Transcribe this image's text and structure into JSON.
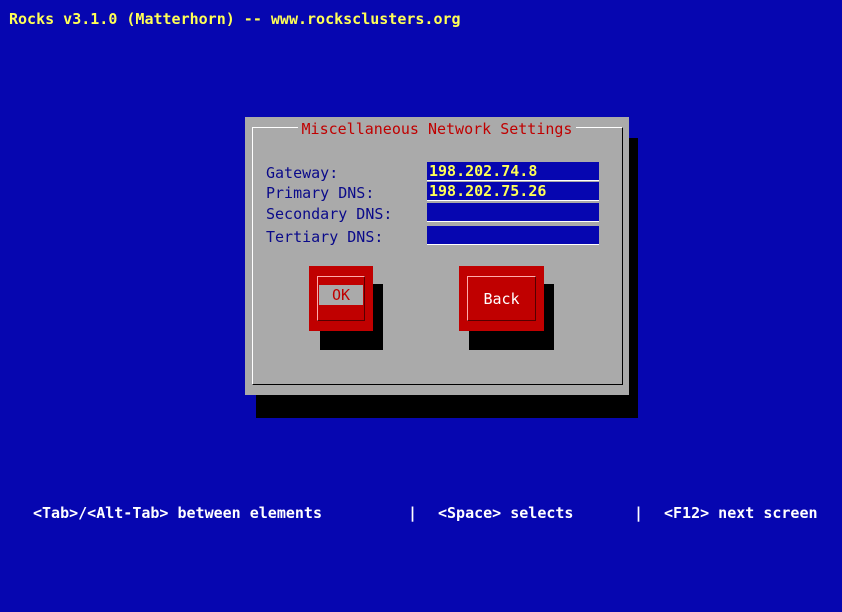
{
  "window": {
    "title": "Rocks v3.1.0 (Matterhorn) -- www.rocksclusters.org"
  },
  "dialog": {
    "title": "Miscellaneous Network Settings",
    "fields": [
      {
        "label": "Gateway:",
        "value": "198.202.74.8"
      },
      {
        "label": "Primary DNS:",
        "value": "198.202.75.26"
      },
      {
        "label": "Secondary DNS:",
        "value": ""
      },
      {
        "label": "Tertiary DNS:",
        "value": ""
      }
    ],
    "buttons": {
      "ok": "OK",
      "back": "Back"
    }
  },
  "status_bar": {
    "hint_tab": "<Tab>/<Alt-Tab> between elements",
    "separator": "|",
    "hint_space": "<Space> selects",
    "hint_f12": "<F12> next screen"
  },
  "colors": {
    "background": "#0606b0",
    "title_text": "#ffff55",
    "dialog_bg": "#aaaaaa",
    "dialog_title": "#c00000",
    "button_bg": "#c00000",
    "field_bg": "#0606b0"
  }
}
